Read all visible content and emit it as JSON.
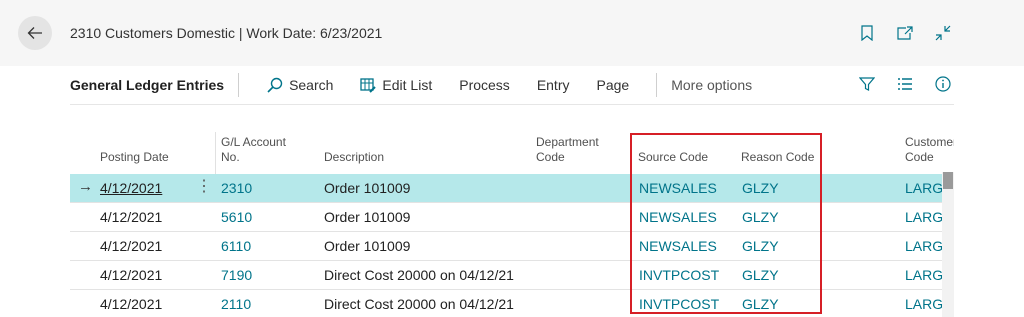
{
  "page": {
    "caption": "2310 Customers Domestic | Work Date: 6/23/2021"
  },
  "actionbar": {
    "title": "General Ledger Entries",
    "search": "Search",
    "edit_list": "Edit List",
    "process": "Process",
    "entry": "Entry",
    "page": "Page",
    "more_options": "More options"
  },
  "columns": {
    "posting_date": "Posting Date",
    "gl_account_l1": "G/L Account",
    "gl_account_l2": "No.",
    "description": "Description",
    "department_l1": "Department",
    "department_l2": "Code",
    "source_code": "Source Code",
    "reason_code": "Reason Code",
    "customer_l1": "Customer",
    "customer_l2": "Code"
  },
  "rows": [
    {
      "posting_date": "4/12/2021",
      "account": "2310",
      "description": "Order 101009",
      "source_code": "NEWSALES",
      "reason_code": "GLZY",
      "customer": "LARG"
    },
    {
      "posting_date": "4/12/2021",
      "account": "5610",
      "description": "Order 101009",
      "source_code": "NEWSALES",
      "reason_code": "GLZY",
      "customer": "LARG"
    },
    {
      "posting_date": "4/12/2021",
      "account": "6110",
      "description": "Order 101009",
      "source_code": "NEWSALES",
      "reason_code": "GLZY",
      "customer": "LARG"
    },
    {
      "posting_date": "4/12/2021",
      "account": "7190",
      "description": "Direct Cost 20000 on 04/12/21",
      "source_code": "INVTPCOST",
      "reason_code": "GLZY",
      "customer": "LARG"
    },
    {
      "posting_date": "4/12/2021",
      "account": "2110",
      "description": "Direct Cost 20000 on 04/12/21",
      "source_code": "INVTPCOST",
      "reason_code": "GLZY",
      "customer": "LARG"
    }
  ],
  "colors": {
    "accent": "#00748a",
    "selected_row": "#b5e8ea",
    "highlight": "#d61f26"
  }
}
